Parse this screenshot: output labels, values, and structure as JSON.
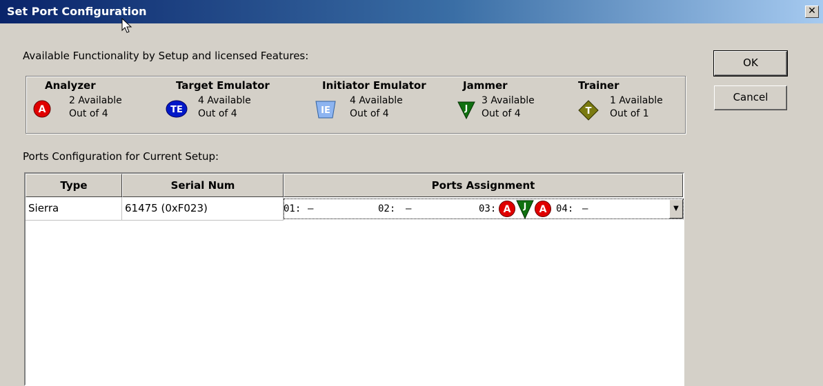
{
  "window": {
    "title": "Set Port Configuration",
    "close_label": "✕"
  },
  "available_label": "Available Functionality by Setup and licensed Features:",
  "features": [
    {
      "name": "Analyzer",
      "available": "2 Available",
      "outof": "Out of 4",
      "icon": "analyzer-icon",
      "badge": "A",
      "color": "#e00000"
    },
    {
      "name": "Target Emulator",
      "available": "4 Available",
      "outof": "Out of 4",
      "icon": "target-emulator-icon",
      "badge": "TE",
      "color": "#0018c8"
    },
    {
      "name": "Initiator Emulator",
      "available": "4 Available",
      "outof": "Out of 4",
      "icon": "initiator-emulator-icon",
      "badge": "IE",
      "color": "#8db4f0"
    },
    {
      "name": "Jammer",
      "available": "3 Available",
      "outof": "Out of 4",
      "icon": "jammer-icon",
      "badge": "J",
      "color": "#107010"
    },
    {
      "name": "Trainer",
      "available": "1 Available",
      "outof": "Out of 1",
      "icon": "trainer-icon",
      "badge": "T",
      "color": "#7a7a10"
    }
  ],
  "ports_label": "Ports Configuration for Current Setup:",
  "table": {
    "columns": [
      "Type",
      "Serial Num",
      "Ports Assignment"
    ],
    "rows": [
      {
        "type": "Sierra",
        "serial": "61475 (0xF023)",
        "ports": [
          {
            "label": "01:",
            "value": "–"
          },
          {
            "label": "02:",
            "value": "–"
          },
          {
            "label": "03:",
            "value": ""
          },
          {
            "label": "04:",
            "value": "–"
          }
        ],
        "port3_icons": [
          "A",
          "J",
          "A"
        ]
      }
    ]
  },
  "buttons": {
    "ok": "OK",
    "cancel": "Cancel"
  },
  "dropdown_arrow": "▼"
}
